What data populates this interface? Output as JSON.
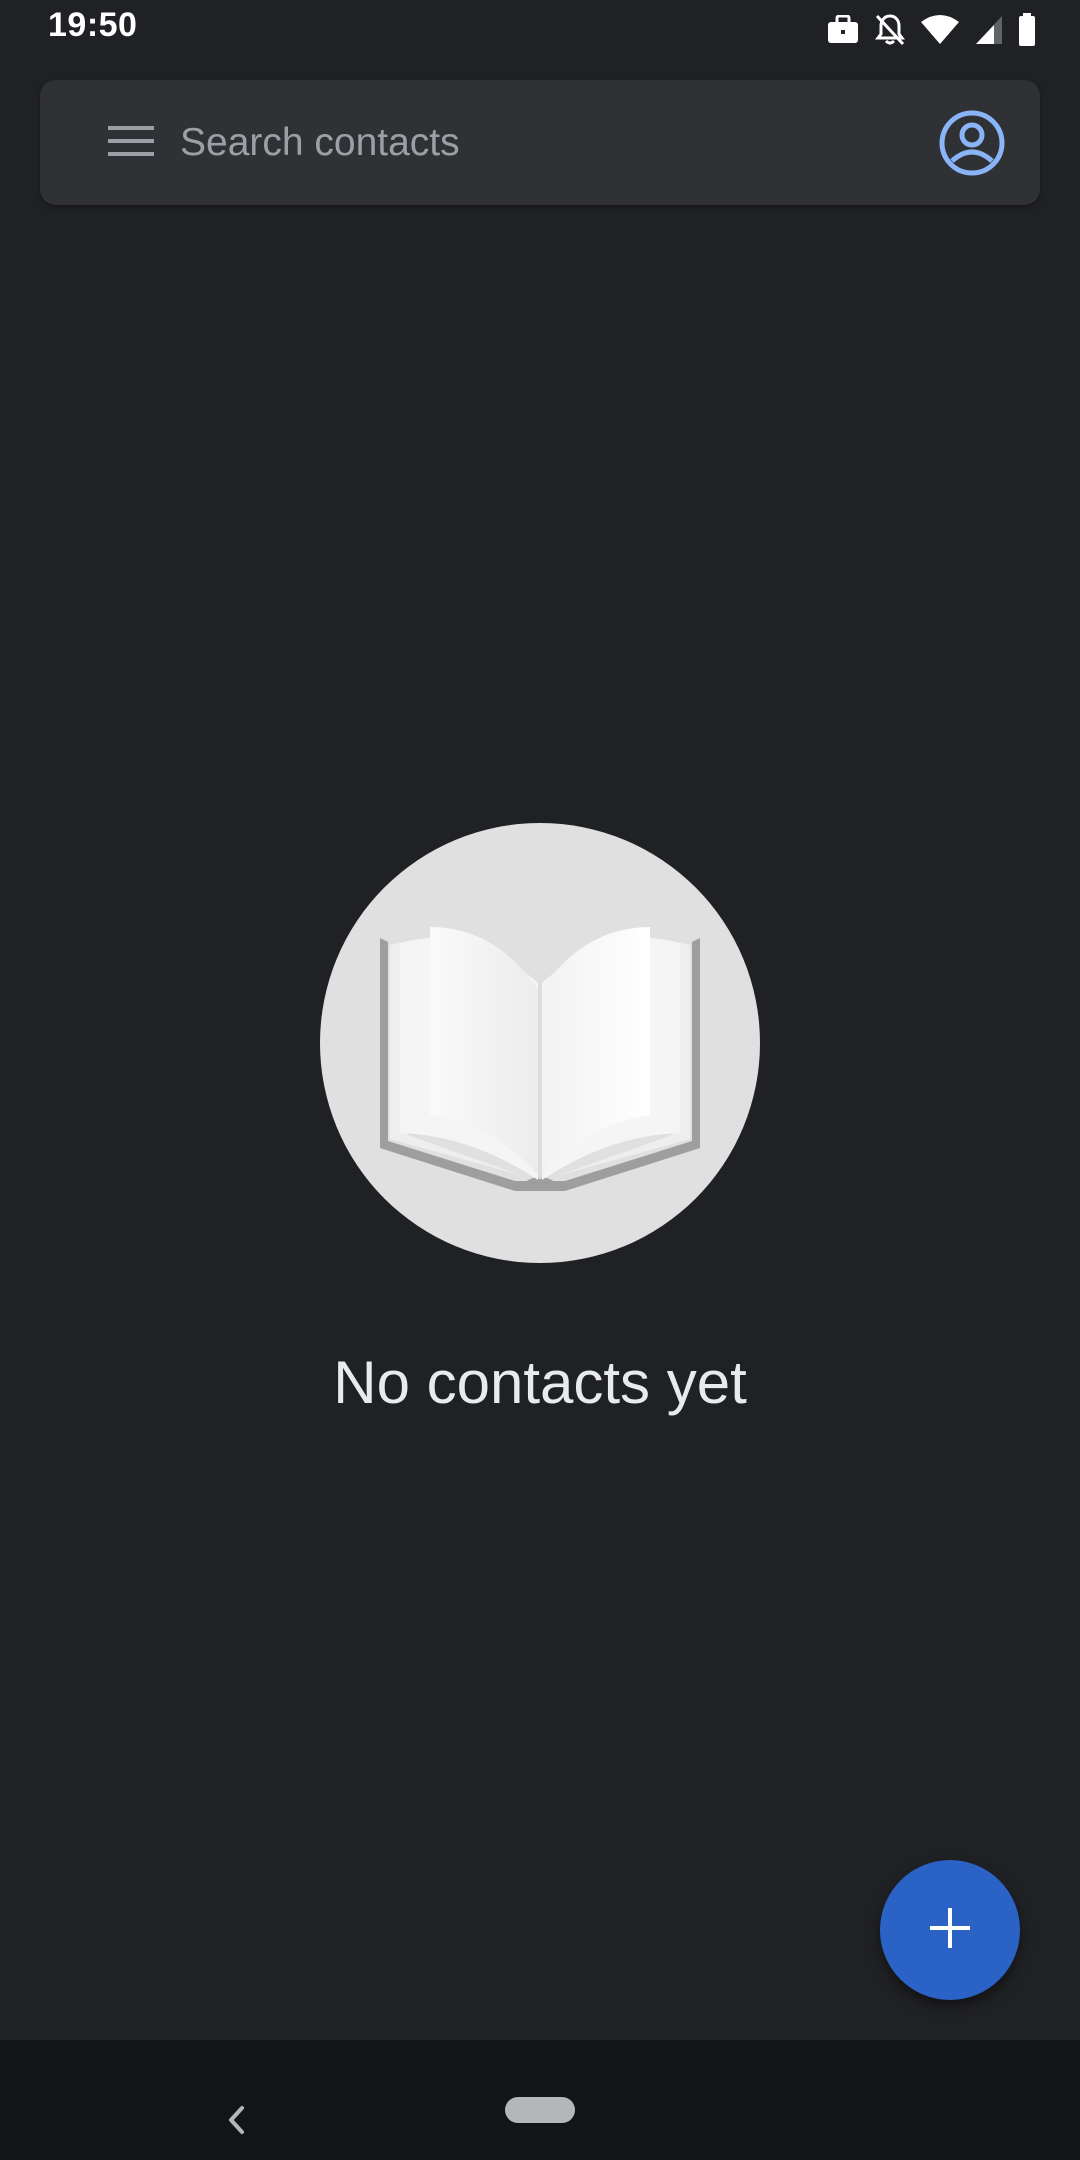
{
  "status_bar": {
    "time": "19:50",
    "icons": [
      "briefcase-icon",
      "notifications-off-icon",
      "wifi-icon",
      "signal-icon",
      "battery-icon"
    ]
  },
  "search": {
    "placeholder": "Search contacts",
    "menu_icon": "menu-icon",
    "account_icon": "account-circle-icon"
  },
  "empty_state": {
    "illustration": "open-book-icon",
    "message": "No contacts yet"
  },
  "fab": {
    "icon": "plus-icon"
  },
  "nav": {
    "back_icon": "back-icon",
    "home_icon": "home-pill-icon"
  },
  "colors": {
    "background": "#202124",
    "search_bar": "#303134",
    "accent_blue": "#8ab4f8",
    "fab": "#2a63c5",
    "nav_bar": "#131416"
  }
}
